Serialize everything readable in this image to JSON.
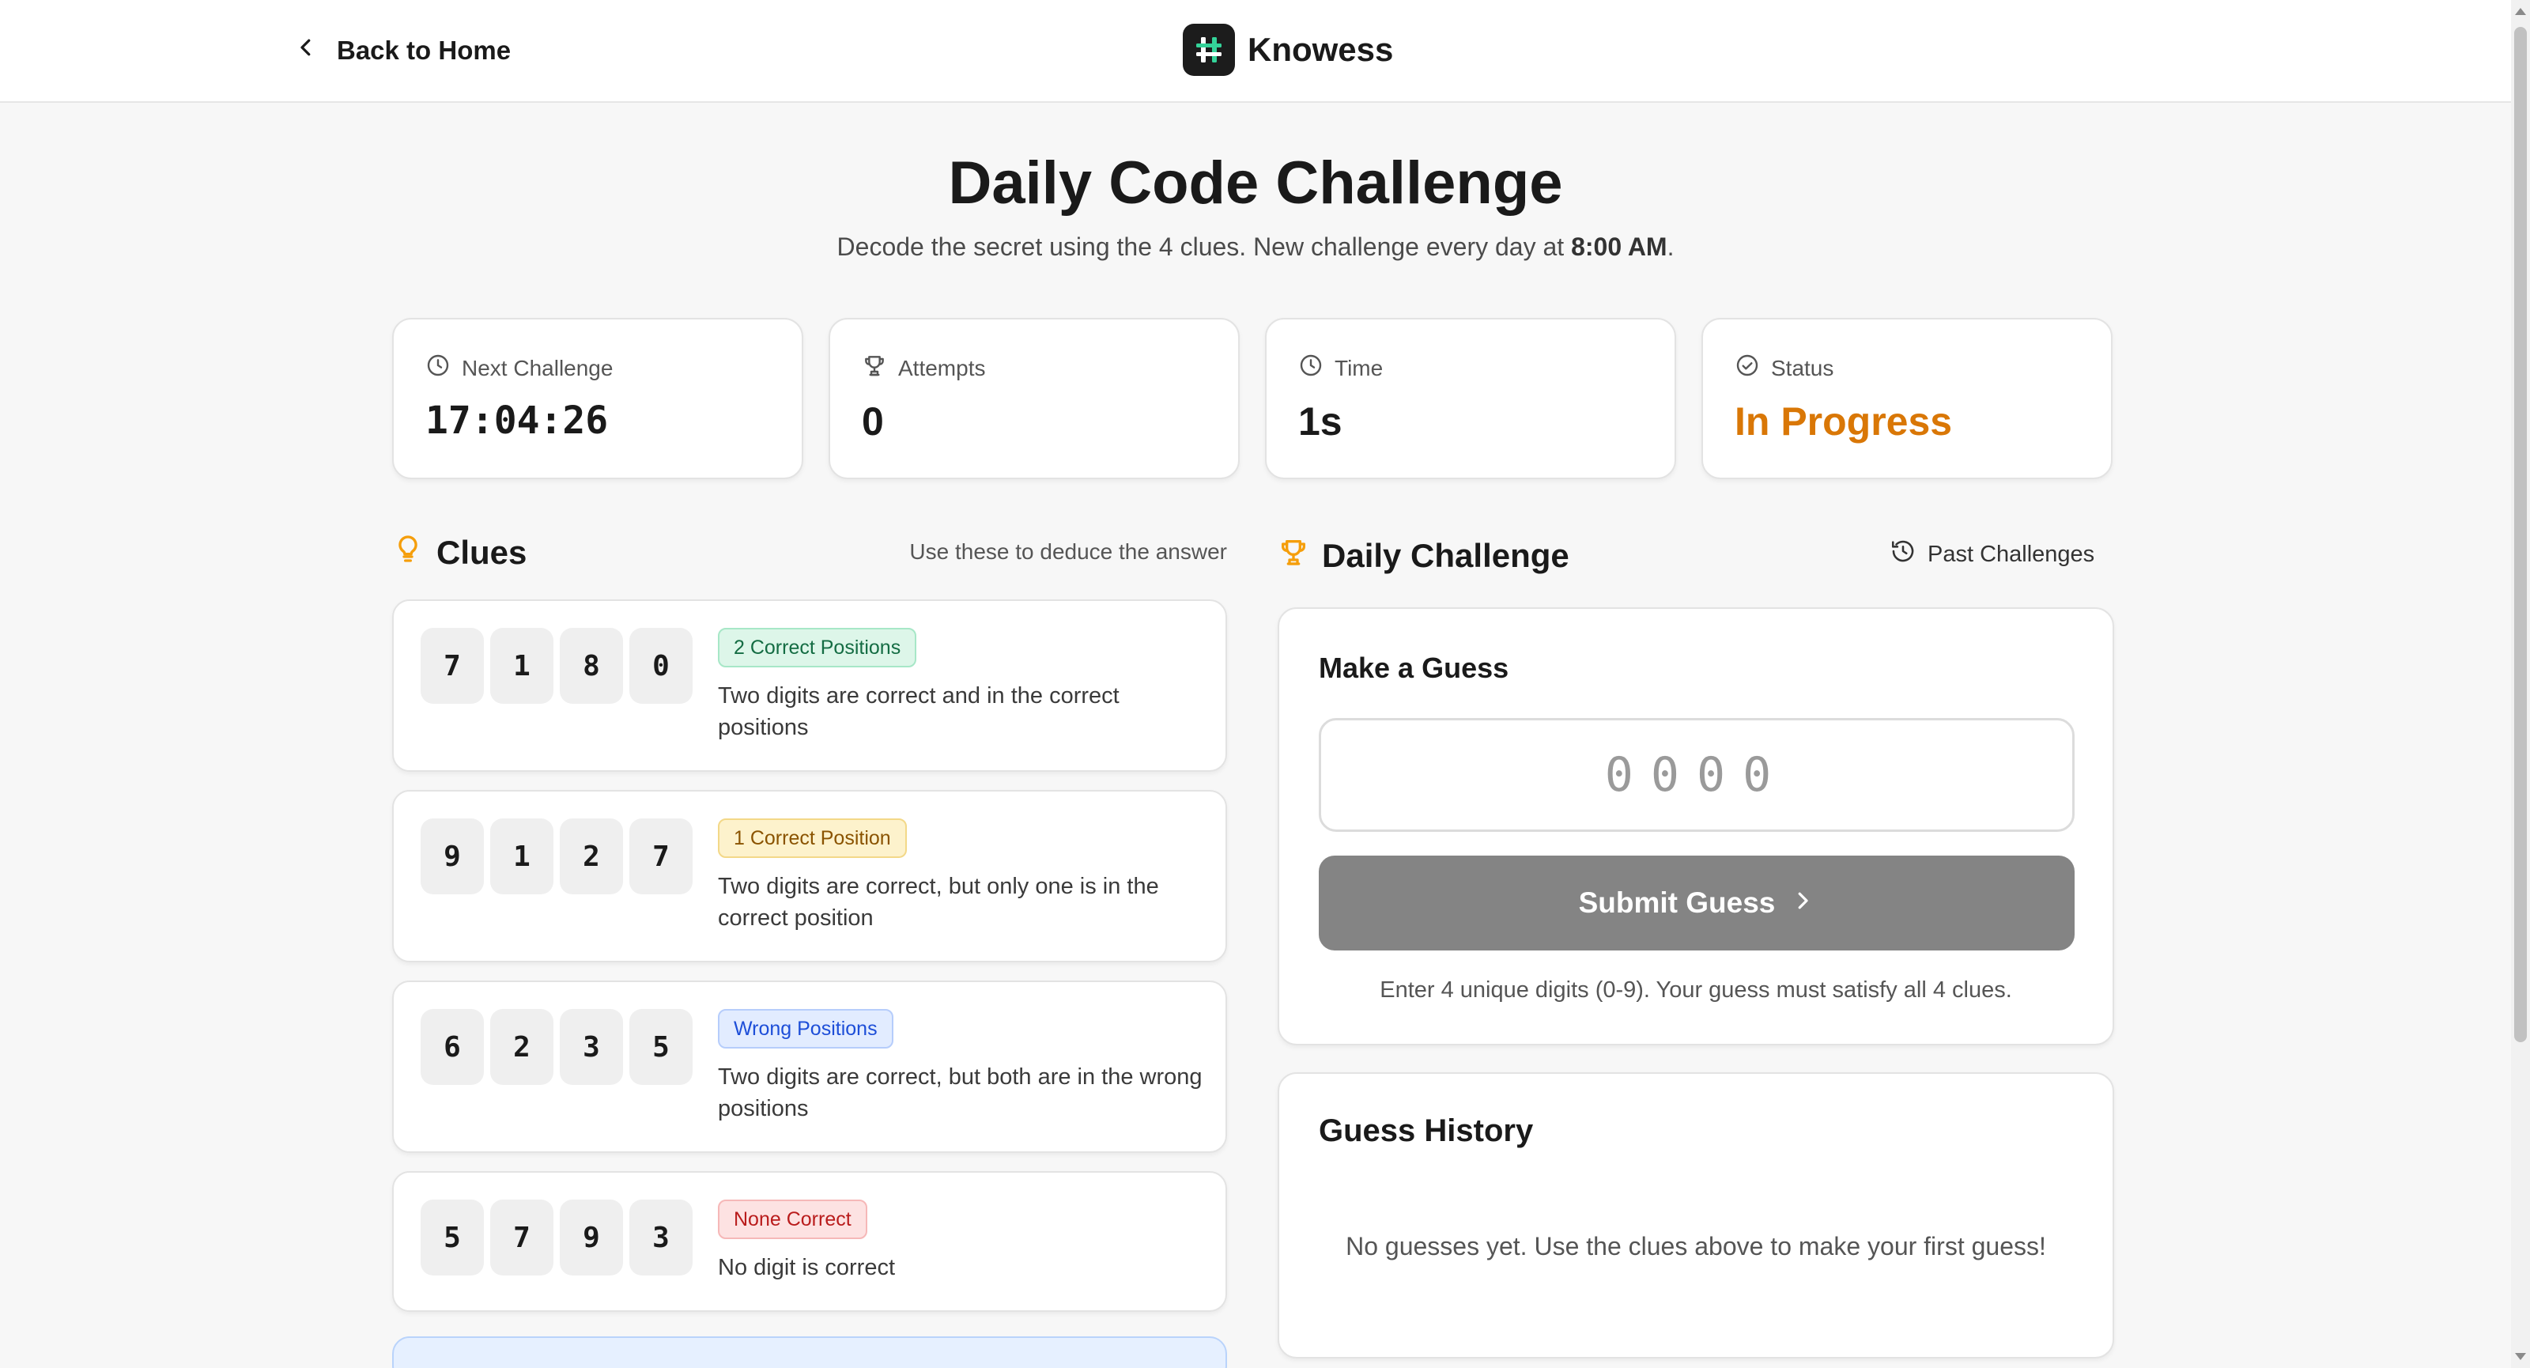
{
  "header": {
    "back_label": "Back to Home",
    "brand_name": "Knowess"
  },
  "page": {
    "title": "Daily Code Challenge",
    "subtitle_prefix": "Decode the secret using the 4 clues. New challenge every day at ",
    "subtitle_time": "8:00 AM",
    "subtitle_suffix": "."
  },
  "stats": [
    {
      "label": "Next Challenge",
      "value": "17:04:26",
      "icon": "clock-icon"
    },
    {
      "label": "Attempts",
      "value": "0",
      "icon": "trophy-icon"
    },
    {
      "label": "Time",
      "value": "1s",
      "icon": "clock-icon"
    },
    {
      "label": "Status",
      "value": "In Progress",
      "icon": "check-circle-icon",
      "color": "#d97706"
    }
  ],
  "clues": {
    "title": "Clues",
    "hint": "Use these to deduce the answer",
    "items": [
      {
        "digits": [
          "7",
          "1",
          "8",
          "0"
        ],
        "badge": "2 Correct Positions",
        "badge_color": "green",
        "description": "Two digits are correct and in the correct positions"
      },
      {
        "digits": [
          "9",
          "1",
          "2",
          "7"
        ],
        "badge": "1 Correct Position",
        "badge_color": "amber",
        "description": "Two digits are correct, but only one is in the correct position"
      },
      {
        "digits": [
          "6",
          "2",
          "3",
          "5"
        ],
        "badge": "Wrong Positions",
        "badge_color": "blue",
        "description": "Two digits are correct, but both are in the wrong positions"
      },
      {
        "digits": [
          "5",
          "7",
          "9",
          "3"
        ],
        "badge": "None Correct",
        "badge_color": "red",
        "description": "No digit is correct"
      }
    ]
  },
  "challenge": {
    "title": "Daily Challenge",
    "past_label": "Past Challenges",
    "make_guess_title": "Make a Guess",
    "guess_placeholder": "0000",
    "guess_value": "",
    "submit_label": "Submit Guess",
    "hint": "Enter 4 unique digits (0-9). Your guess must satisfy all 4 clues."
  },
  "history": {
    "title": "Guess History",
    "empty_text": "No guesses yet. Use the clues above to make your first guess!"
  },
  "colors": {
    "accent": "#f59e0b",
    "status": "#d97706",
    "submit_disabled": "#848484"
  }
}
